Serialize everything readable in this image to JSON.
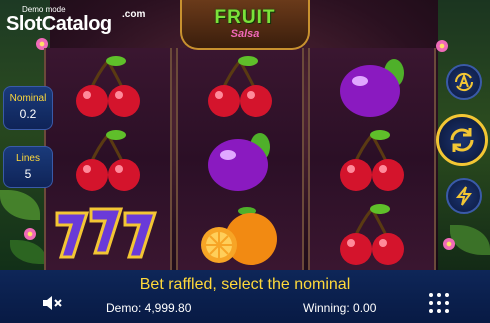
{
  "branding": {
    "demo_mode": "Demo mode",
    "logo_slot": "Slot",
    "logo_catalog": "Catalog",
    "logo_com": ".com"
  },
  "game_title": {
    "line1": "FRUIT",
    "line2": "Salsa"
  },
  "side_panel": {
    "nominal_label": "Nominal",
    "nominal_value": "0.2",
    "lines_label": "Lines",
    "lines_value": "5"
  },
  "reels": [
    [
      "cherry",
      "cherry",
      "seven"
    ],
    [
      "cherry",
      "plum",
      "orange"
    ],
    [
      "plum",
      "cherry",
      "cherry"
    ]
  ],
  "controls": {
    "autoplay_icon": "autoplay-a-icon",
    "spin_icon": "spin-arrows-icon",
    "turbo_icon": "lightning-icon"
  },
  "status": {
    "message": "Bet raffled, select the nominal",
    "demo_balance": "Demo: 4,999.80",
    "winning": "Winning: 0.00"
  },
  "colors": {
    "accent_gold": "#f3c634",
    "panel_blue": "#0e2658",
    "message_yellow": "#ffd93a"
  }
}
